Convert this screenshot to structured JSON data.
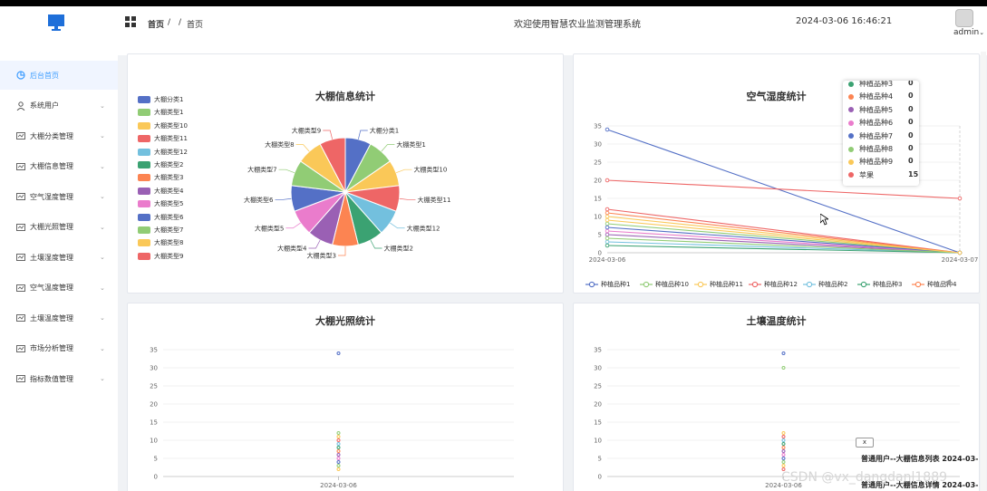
{
  "header": {
    "breadcrumb_home": "首页",
    "breadcrumb_sep1": "/",
    "breadcrumb_sep2": "/",
    "breadcrumb_current": "首页",
    "title": "欢迎使用智慧农业监测管理系统",
    "datetime": "2024-03-06 16:46:21",
    "user": "admin"
  },
  "sidebar": {
    "items": [
      {
        "label": "后台首页",
        "icon": "dashboard-icon",
        "active": true,
        "arrow": ""
      },
      {
        "label": "系统用户",
        "icon": "user-icon",
        "active": false,
        "arrow": "⌄"
      },
      {
        "label": "大棚分类管理",
        "icon": "list-icon",
        "active": false,
        "arrow": "⌄"
      },
      {
        "label": "大棚信息管理",
        "icon": "list-icon",
        "active": false,
        "arrow": "⌄"
      },
      {
        "label": "空气湿度管理",
        "icon": "list-icon",
        "active": false,
        "arrow": "⌄"
      },
      {
        "label": "大棚光照管理",
        "icon": "list-icon",
        "active": false,
        "arrow": "⌄"
      },
      {
        "label": "土壤湿度管理",
        "icon": "list-icon",
        "active": false,
        "arrow": "⌄"
      },
      {
        "label": "空气温度管理",
        "icon": "list-icon",
        "active": false,
        "arrow": "⌄"
      },
      {
        "label": "土壤温度管理",
        "icon": "list-icon",
        "active": false,
        "arrow": "⌄"
      },
      {
        "label": "市场分析管理",
        "icon": "list-icon",
        "active": false,
        "arrow": "⌄"
      },
      {
        "label": "指标数值管理",
        "icon": "list-icon",
        "active": false,
        "arrow": "⌄"
      }
    ]
  },
  "colors": [
    "#5470c6",
    "#91cc75",
    "#fac858",
    "#ee6666",
    "#73c0de",
    "#3ba272",
    "#fc8452",
    "#9a60b4",
    "#ea7ccc"
  ],
  "chart_data": [
    {
      "type": "pie",
      "title": "大棚信息统计",
      "legend_position": "left",
      "categories": [
        "大棚分类1",
        "大棚类型1",
        "大棚类型10",
        "大棚类型11",
        "大棚类型12",
        "大棚类型2",
        "大棚类型3",
        "大棚类型4",
        "大棚类型5",
        "大棚类型6",
        "大棚类型7",
        "大棚类型8",
        "大棚类型9"
      ],
      "values": [
        1,
        1,
        1,
        1,
        1,
        1,
        1,
        1,
        1,
        1,
        1,
        1,
        1
      ]
    },
    {
      "type": "line",
      "title": "空气湿度统计",
      "x": [
        "2024-03-06",
        "2024-03-07"
      ],
      "ylim": [
        0,
        35
      ],
      "yticks": [
        0,
        5,
        10,
        15,
        20,
        25,
        30,
        35
      ],
      "legend_position": "bottom",
      "legend_visible": [
        "种植品种1",
        "种植品种10",
        "种植品种11",
        "种植品种12",
        "种植品种2",
        "种植品种3",
        "种植品种4"
      ],
      "series": [
        {
          "name": "种植品种1",
          "values": [
            34,
            0
          ]
        },
        {
          "name": "种植品种10",
          "values": [
            8,
            0
          ]
        },
        {
          "name": "种植品种11",
          "values": [
            10,
            0
          ]
        },
        {
          "name": "种植品种12",
          "values": [
            12,
            0
          ]
        },
        {
          "name": "种植品种2",
          "values": [
            3,
            0
          ]
        },
        {
          "name": "种植品种3",
          "values": [
            2,
            0
          ]
        },
        {
          "name": "种植品种4",
          "values": [
            11,
            0
          ]
        },
        {
          "name": "种植品种5",
          "values": [
            5,
            0
          ]
        },
        {
          "name": "种植品种6",
          "values": [
            6,
            0
          ]
        },
        {
          "name": "种植品种7",
          "values": [
            7,
            0
          ]
        },
        {
          "name": "种植品种8",
          "values": [
            4,
            0
          ]
        },
        {
          "name": "种植品种9",
          "values": [
            9,
            0
          ]
        },
        {
          "name": "苹果",
          "values": [
            20,
            15
          ]
        }
      ],
      "tooltip": [
        {
          "name": "种植品种3",
          "value": "0"
        },
        {
          "name": "种植品种4",
          "value": "0"
        },
        {
          "name": "种植品种5",
          "value": "0"
        },
        {
          "name": "种植品种6",
          "value": "0"
        },
        {
          "name": "种植品种7",
          "value": "0"
        },
        {
          "name": "种植品种8",
          "value": "0"
        },
        {
          "name": "种植品种9",
          "value": "0"
        },
        {
          "name": "苹果",
          "value": "15"
        }
      ]
    },
    {
      "type": "scatter",
      "title": "大棚光照统计",
      "x": [
        "2024-03-06"
      ],
      "ylim": [
        0,
        35
      ],
      "yticks": [
        0,
        5,
        10,
        15,
        20,
        25,
        30,
        35
      ],
      "values": [
        34,
        12,
        11,
        10,
        9,
        8,
        7,
        6,
        5,
        4,
        3,
        2
      ]
    },
    {
      "type": "scatter",
      "title": "土壤温度统计",
      "x": [
        "2024-03-06"
      ],
      "ylim": [
        0,
        35
      ],
      "yticks": [
        0,
        5,
        10,
        15,
        20,
        25,
        30,
        35
      ],
      "values": [
        34,
        30,
        12,
        11,
        10,
        9,
        8,
        7,
        6,
        5,
        4,
        3,
        2
      ]
    }
  ],
  "notices": [
    "普通用户--大棚信息列表 2024-03-",
    "普通用户--大棚信息详情 2024-03-"
  ],
  "close_label": "x",
  "watermark": "CSDN @vx_dangdanl1889"
}
